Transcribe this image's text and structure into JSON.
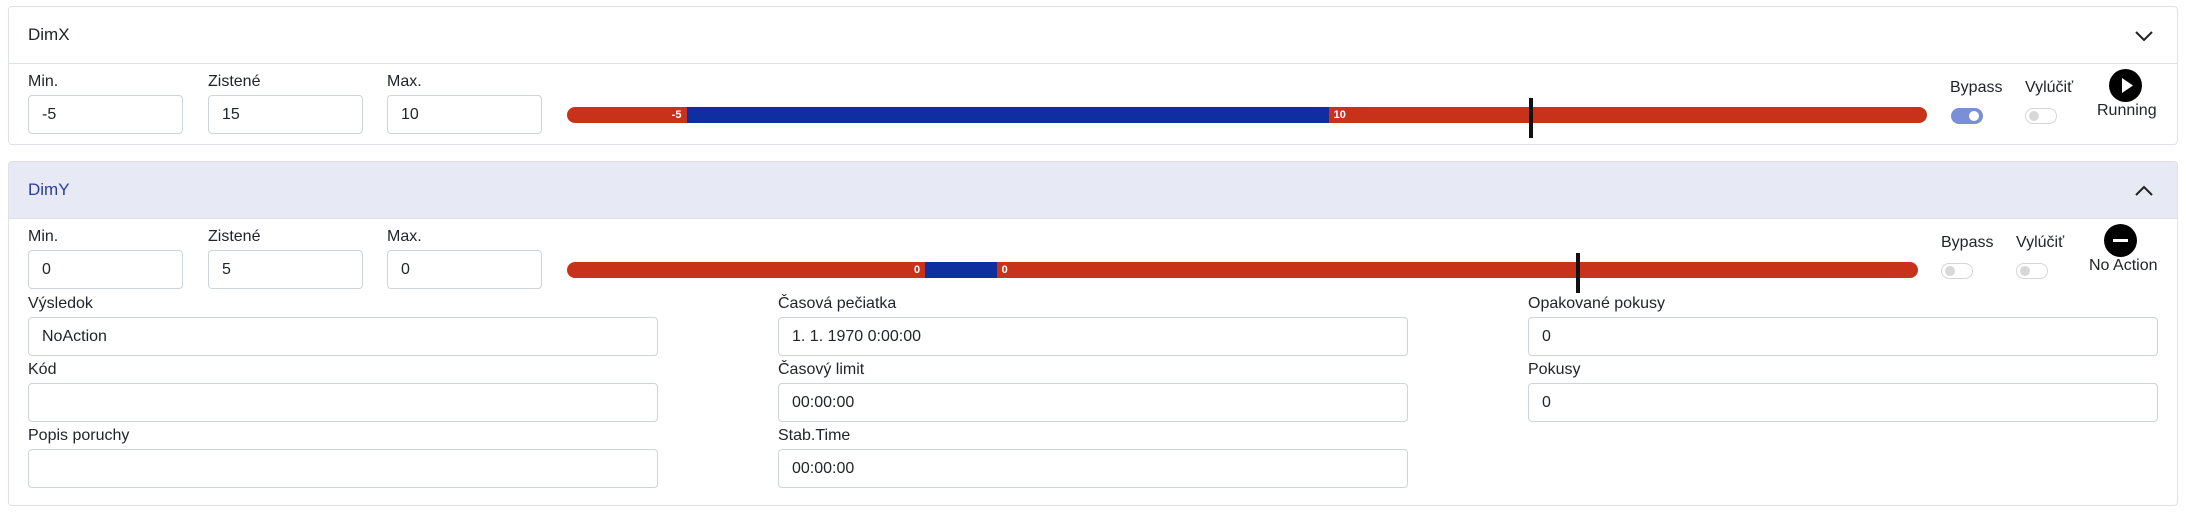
{
  "panels": {
    "dimx": {
      "title": "DimX",
      "min_label": "Min.",
      "min_value": "-5",
      "measured_label": "Zistené",
      "measured_value": "15",
      "max_label": "Max.",
      "max_value": "10",
      "bar": {
        "range_start_label": "-5",
        "range_end_label": "10",
        "range_start_fraction": 0.088,
        "range_end_fraction": 0.56,
        "marker_fraction": 0.709
      },
      "bypass_label": "Bypass",
      "bypass_on": true,
      "exclude_label": "Vylúčiť",
      "exclude_on": false,
      "status_icon": "play-circle-icon",
      "status_text": "Running",
      "expanded": false
    },
    "dimy": {
      "title": "DimY",
      "min_label": "Min.",
      "min_value": "0",
      "measured_label": "Zistené",
      "measured_value": "5",
      "max_label": "Max.",
      "max_value": "0",
      "bar": {
        "range_start_label": "0",
        "range_end_label": "0",
        "range_start_fraction": 0.265,
        "range_end_fraction": 0.318,
        "marker_fraction": 0.748
      },
      "bypass_label": "Bypass",
      "bypass_on": false,
      "exclude_label": "Vylúčiť",
      "exclude_on": false,
      "status_icon": "minus-circle-icon",
      "status_text": "No Action",
      "expanded": true,
      "details": {
        "result_label": "Výsledok",
        "result_value": "NoAction",
        "timestamp_label": "Časová pečiatka",
        "timestamp_value": "1. 1. 1970 0:00:00",
        "retries_label": "Opakované pokusy",
        "retries_value": "0",
        "code_label": "Kód",
        "code_value": "",
        "timeout_label": "Časový limit",
        "timeout_value": "00:00:00",
        "attempts_label": "Pokusy",
        "attempts_value": "0",
        "fault_label": "Popis poruchy",
        "fault_value": "",
        "stab_label": "Stab.Time",
        "stab_value": "00:00:00"
      }
    }
  },
  "colors": {
    "bar_out": "#c8321b",
    "bar_in": "#0f2fa0",
    "header_active": "#e7e9f5",
    "title_active": "#2b3d9a"
  }
}
